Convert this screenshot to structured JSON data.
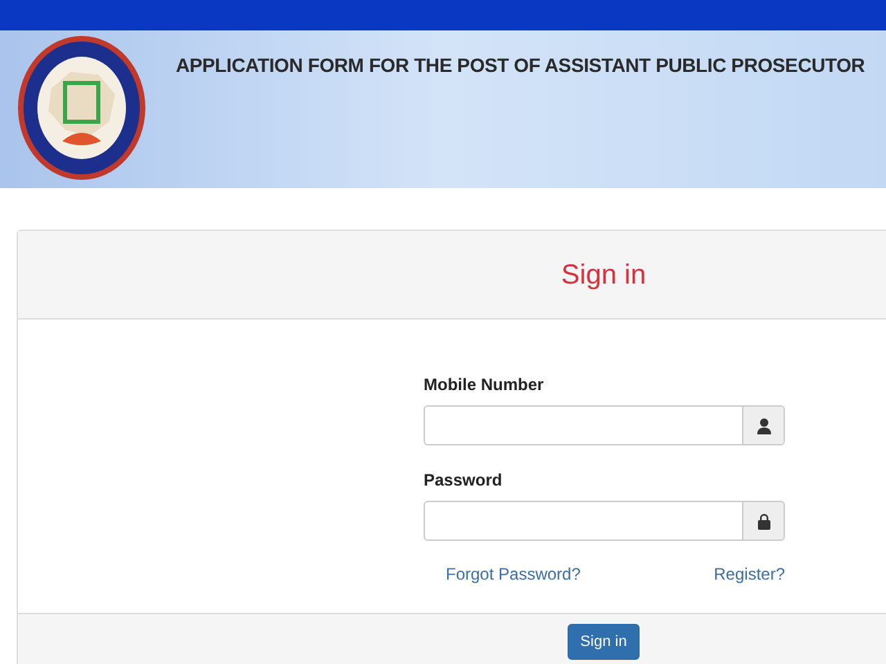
{
  "header": {
    "title": "APPLICATION FORM FOR THE POST OF ASSISTANT PUBLIC PROSECUTOR"
  },
  "panel": {
    "heading": "Sign in"
  },
  "fields": [
    {
      "label": "Mobile Number",
      "kind": "user"
    },
    {
      "label": "Password",
      "kind": "lock"
    }
  ],
  "links": [
    "Forgot Password?",
    "Register?"
  ],
  "submit": "Sign in"
}
